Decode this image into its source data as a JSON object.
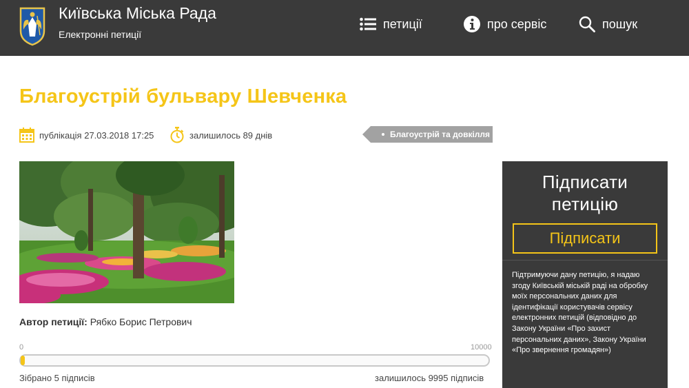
{
  "header": {
    "site_title": "Київська Міська Рада",
    "site_subtitle": "Електронні петиції",
    "nav": {
      "petitions": "петиції",
      "about": "про сервіс",
      "search": "пошук"
    }
  },
  "petition": {
    "title": "Благоустрій бульвару Шевченка",
    "published": "публікація 27.03.2018 17:25",
    "remaining_days": "залишилось 89 днів",
    "category": "Благоустрій та довкілля",
    "author_label": "Автор петиції:",
    "author_name": "Рябко Борис Петрович"
  },
  "progress": {
    "scale_min": "0",
    "scale_max": "10000",
    "collected": 5,
    "goal": 10000,
    "collected_text": "Зібрано 5 підписів",
    "remaining_text": "залишилось 9995 підписів"
  },
  "sign_panel": {
    "heading_line1": "Підписати",
    "heading_line2": "петицію",
    "button_label": "Підписати",
    "consent_text": "Підтримуючи дану петицію, я надаю згоду Київській міській раді на обробку моїх персональних даних для ідентифікації користувачів сервісу електронних петицій (відповідно до Закону України «Про захист персональних даних», Закону України «Про звернення громадян»)"
  },
  "colors": {
    "accent": "#f5c518",
    "header_bg": "#3a3a3a",
    "tag_bg": "#a2a2a2"
  },
  "icons": {
    "logo": "kyiv-coat-of-arms",
    "petitions": "list-icon",
    "about": "info-icon",
    "search": "search-icon",
    "published": "calendar-icon",
    "remaining": "stopwatch-icon"
  }
}
